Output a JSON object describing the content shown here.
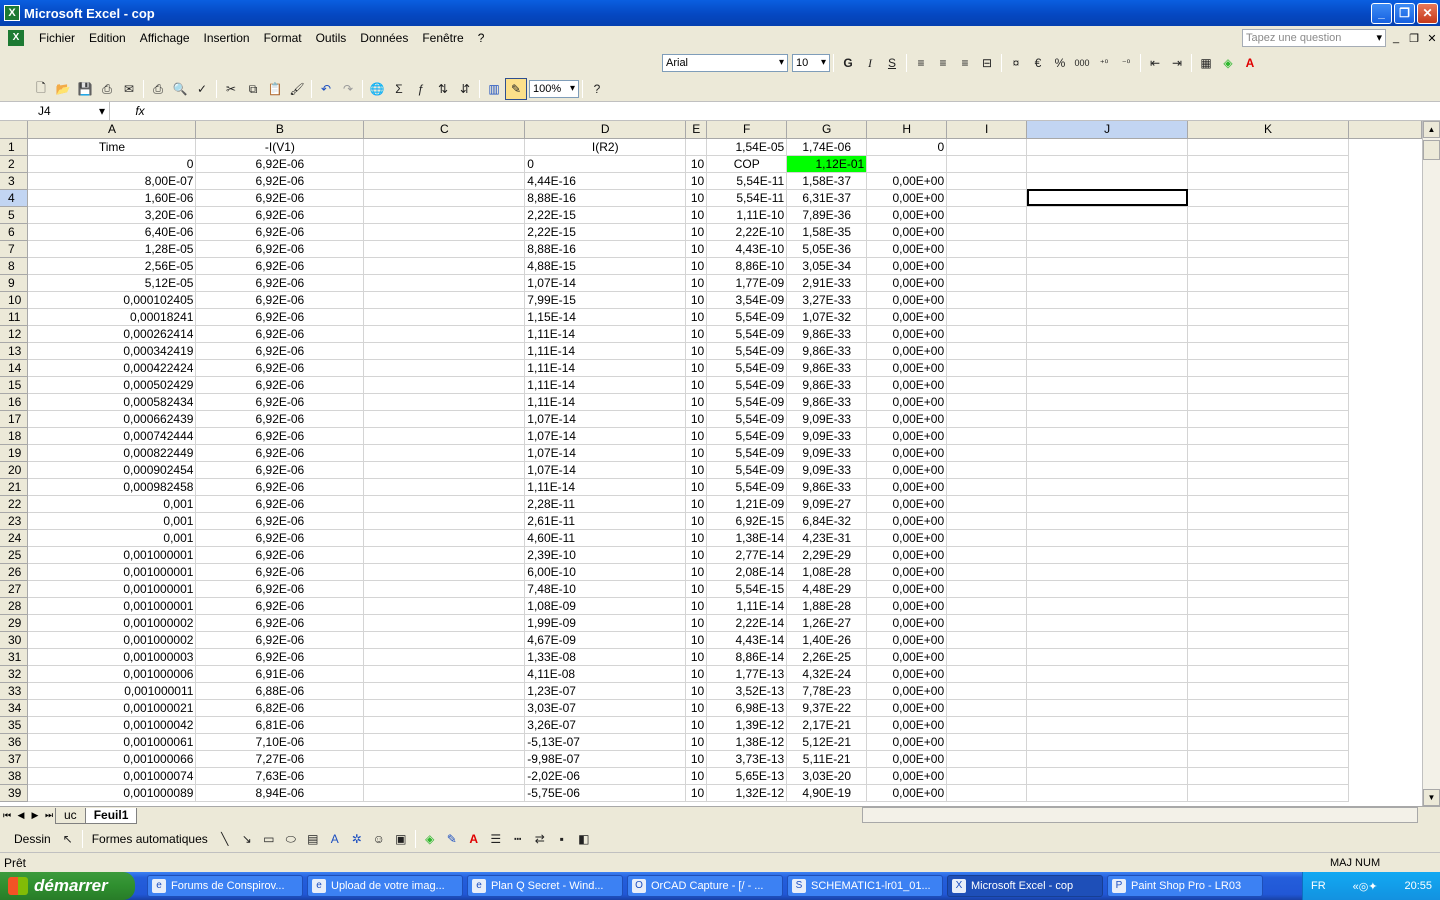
{
  "window": {
    "title": "Microsoft Excel - cop",
    "controls": [
      "_",
      "❐",
      "✕"
    ]
  },
  "menu": {
    "items": [
      "Fichier",
      "Edition",
      "Affichage",
      "Insertion",
      "Format",
      "Outils",
      "Données",
      "Fenêtre",
      "?"
    ],
    "help_placeholder": "Tapez une question",
    "mdi_controls": [
      "_",
      "❐",
      "✕"
    ]
  },
  "format_toolbar": {
    "font": "Arial",
    "size": "10",
    "bold": "G",
    "italic": "I",
    "underline": "S",
    "euro": "€",
    "percent": "%",
    "thousands": "000"
  },
  "standard_toolbar": {
    "zoom": "100%",
    "sigma": "Σ"
  },
  "formula_bar": {
    "name_box": "J4",
    "fx": "fx",
    "content": ""
  },
  "sheet": {
    "columns": [
      "A",
      "B",
      "C",
      "D",
      "E",
      "F",
      "G",
      "H",
      "I",
      "J",
      "K"
    ],
    "selected_column": "J",
    "selected_row": "4",
    "active_cell": "J4",
    "rows": [
      [
        "1",
        "Time",
        "-I(V1)",
        "",
        "I(R2)",
        "",
        "1,54E-05",
        "1,74E-06",
        "0",
        "",
        "",
        ""
      ],
      [
        "2",
        "0",
        "6,92E-06",
        "",
        "0",
        "10",
        "COP",
        "1,12E-01",
        "",
        "",
        "",
        ""
      ],
      [
        "3",
        "8,00E-07",
        "6,92E-06",
        "",
        "4,44E-16",
        "10",
        "5,54E-11",
        "1,58E-37",
        "0,00E+00",
        "",
        "",
        ""
      ],
      [
        "4",
        "1,60E-06",
        "6,92E-06",
        "",
        "8,88E-16",
        "10",
        "5,54E-11",
        "6,31E-37",
        "0,00E+00",
        "",
        "",
        ""
      ],
      [
        "5",
        "3,20E-06",
        "6,92E-06",
        "",
        "2,22E-15",
        "10",
        "1,11E-10",
        "7,89E-36",
        "0,00E+00",
        "",
        "",
        ""
      ],
      [
        "6",
        "6,40E-06",
        "6,92E-06",
        "",
        "2,22E-15",
        "10",
        "2,22E-10",
        "1,58E-35",
        "0,00E+00",
        "",
        "",
        ""
      ],
      [
        "7",
        "1,28E-05",
        "6,92E-06",
        "",
        "8,88E-16",
        "10",
        "4,43E-10",
        "5,05E-36",
        "0,00E+00",
        "",
        "",
        ""
      ],
      [
        "8",
        "2,56E-05",
        "6,92E-06",
        "",
        "4,88E-15",
        "10",
        "8,86E-10",
        "3,05E-34",
        "0,00E+00",
        "",
        "",
        ""
      ],
      [
        "9",
        "5,12E-05",
        "6,92E-06",
        "",
        "1,07E-14",
        "10",
        "1,77E-09",
        "2,91E-33",
        "0,00E+00",
        "",
        "",
        ""
      ],
      [
        "10",
        "0,000102405",
        "6,92E-06",
        "",
        "7,99E-15",
        "10",
        "3,54E-09",
        "3,27E-33",
        "0,00E+00",
        "",
        "",
        ""
      ],
      [
        "11",
        "0,00018241",
        "6,92E-06",
        "",
        "1,15E-14",
        "10",
        "5,54E-09",
        "1,07E-32",
        "0,00E+00",
        "",
        "",
        ""
      ],
      [
        "12",
        "0,000262414",
        "6,92E-06",
        "",
        "1,11E-14",
        "10",
        "5,54E-09",
        "9,86E-33",
        "0,00E+00",
        "",
        "",
        ""
      ],
      [
        "13",
        "0,000342419",
        "6,92E-06",
        "",
        "1,11E-14",
        "10",
        "5,54E-09",
        "9,86E-33",
        "0,00E+00",
        "",
        "",
        ""
      ],
      [
        "14",
        "0,000422424",
        "6,92E-06",
        "",
        "1,11E-14",
        "10",
        "5,54E-09",
        "9,86E-33",
        "0,00E+00",
        "",
        "",
        ""
      ],
      [
        "15",
        "0,000502429",
        "6,92E-06",
        "",
        "1,11E-14",
        "10",
        "5,54E-09",
        "9,86E-33",
        "0,00E+00",
        "",
        "",
        ""
      ],
      [
        "16",
        "0,000582434",
        "6,92E-06",
        "",
        "1,11E-14",
        "10",
        "5,54E-09",
        "9,86E-33",
        "0,00E+00",
        "",
        "",
        ""
      ],
      [
        "17",
        "0,000662439",
        "6,92E-06",
        "",
        "1,07E-14",
        "10",
        "5,54E-09",
        "9,09E-33",
        "0,00E+00",
        "",
        "",
        ""
      ],
      [
        "18",
        "0,000742444",
        "6,92E-06",
        "",
        "1,07E-14",
        "10",
        "5,54E-09",
        "9,09E-33",
        "0,00E+00",
        "",
        "",
        ""
      ],
      [
        "19",
        "0,000822449",
        "6,92E-06",
        "",
        "1,07E-14",
        "10",
        "5,54E-09",
        "9,09E-33",
        "0,00E+00",
        "",
        "",
        ""
      ],
      [
        "20",
        "0,000902454",
        "6,92E-06",
        "",
        "1,07E-14",
        "10",
        "5,54E-09",
        "9,09E-33",
        "0,00E+00",
        "",
        "",
        ""
      ],
      [
        "21",
        "0,000982458",
        "6,92E-06",
        "",
        "1,11E-14",
        "10",
        "5,54E-09",
        "9,86E-33",
        "0,00E+00",
        "",
        "",
        ""
      ],
      [
        "22",
        "0,001",
        "6,92E-06",
        "",
        "2,28E-11",
        "10",
        "1,21E-09",
        "9,09E-27",
        "0,00E+00",
        "",
        "",
        ""
      ],
      [
        "23",
        "0,001",
        "6,92E-06",
        "",
        "2,61E-11",
        "10",
        "6,92E-15",
        "6,84E-32",
        "0,00E+00",
        "",
        "",
        ""
      ],
      [
        "24",
        "0,001",
        "6,92E-06",
        "",
        "4,60E-11",
        "10",
        "1,38E-14",
        "4,23E-31",
        "0,00E+00",
        "",
        "",
        ""
      ],
      [
        "25",
        "0,001000001",
        "6,92E-06",
        "",
        "2,39E-10",
        "10",
        "2,77E-14",
        "2,29E-29",
        "0,00E+00",
        "",
        "",
        ""
      ],
      [
        "26",
        "0,001000001",
        "6,92E-06",
        "",
        "6,00E-10",
        "10",
        "2,08E-14",
        "1,08E-28",
        "0,00E+00",
        "",
        "",
        ""
      ],
      [
        "27",
        "0,001000001",
        "6,92E-06",
        "",
        "7,48E-10",
        "10",
        "5,54E-15",
        "4,48E-29",
        "0,00E+00",
        "",
        "",
        ""
      ],
      [
        "28",
        "0,001000001",
        "6,92E-06",
        "",
        "1,08E-09",
        "10",
        "1,11E-14",
        "1,88E-28",
        "0,00E+00",
        "",
        "",
        ""
      ],
      [
        "29",
        "0,001000002",
        "6,92E-06",
        "",
        "1,99E-09",
        "10",
        "2,22E-14",
        "1,26E-27",
        "0,00E+00",
        "",
        "",
        ""
      ],
      [
        "30",
        "0,001000002",
        "6,92E-06",
        "",
        "4,67E-09",
        "10",
        "4,43E-14",
        "1,40E-26",
        "0,00E+00",
        "",
        "",
        ""
      ],
      [
        "31",
        "0,001000003",
        "6,92E-06",
        "",
        "1,33E-08",
        "10",
        "8,86E-14",
        "2,26E-25",
        "0,00E+00",
        "",
        "",
        ""
      ],
      [
        "32",
        "0,001000006",
        "6,91E-06",
        "",
        "4,11E-08",
        "10",
        "1,77E-13",
        "4,32E-24",
        "0,00E+00",
        "",
        "",
        ""
      ],
      [
        "33",
        "0,001000011",
        "6,88E-06",
        "",
        "1,23E-07",
        "10",
        "3,52E-13",
        "7,78E-23",
        "0,00E+00",
        "",
        "",
        ""
      ],
      [
        "34",
        "0,001000021",
        "6,82E-06",
        "",
        "3,03E-07",
        "10",
        "6,98E-13",
        "9,37E-22",
        "0,00E+00",
        "",
        "",
        ""
      ],
      [
        "35",
        "0,001000042",
        "6,81E-06",
        "",
        "3,26E-07",
        "10",
        "1,39E-12",
        "2,17E-21",
        "0,00E+00",
        "",
        "",
        ""
      ],
      [
        "36",
        "0,001000061",
        "7,10E-06",
        "",
        "-5,13E-07",
        "10",
        "1,38E-12",
        "5,12E-21",
        "0,00E+00",
        "",
        "",
        ""
      ],
      [
        "37",
        "0,001000066",
        "7,27E-06",
        "",
        "-9,98E-07",
        "10",
        "3,73E-13",
        "5,11E-21",
        "0,00E+00",
        "",
        "",
        ""
      ],
      [
        "38",
        "0,001000074",
        "7,63E-06",
        "",
        "-2,02E-06",
        "10",
        "5,65E-13",
        "3,03E-20",
        "0,00E+00",
        "",
        "",
        ""
      ],
      [
        "39",
        "0,001000089",
        "8,94E-06",
        "",
        "-5,75E-06",
        "10",
        "1,32E-12",
        "4,90E-19",
        "0,00E+00",
        "",
        "",
        ""
      ]
    ],
    "cop_fill": "#00ff00"
  },
  "tabs": {
    "items": [
      "uc",
      "Feuil1"
    ],
    "active": "Feuil1"
  },
  "draw_toolbar": {
    "dessin": "Dessin",
    "formes": "Formes automatiques"
  },
  "status": {
    "text": "Prêt",
    "indicators": "MAJ NUM"
  },
  "taskbar": {
    "start": "démarrer",
    "tasks": [
      {
        "label": "Forums de Conspirov...",
        "icon": "e"
      },
      {
        "label": "Upload de votre imag...",
        "icon": "e"
      },
      {
        "label": "Plan Q Secret - Wind...",
        "icon": "e"
      },
      {
        "label": "OrCAD Capture - [/ - ...",
        "icon": "O"
      },
      {
        "label": "SCHEMATIC1-lr01_01...",
        "icon": "S"
      },
      {
        "label": "Microsoft Excel - cop",
        "icon": "X"
      },
      {
        "label": "Paint Shop Pro - LR03",
        "icon": "P"
      }
    ],
    "active_task": 5,
    "lang": "FR",
    "clock": "20:55"
  }
}
